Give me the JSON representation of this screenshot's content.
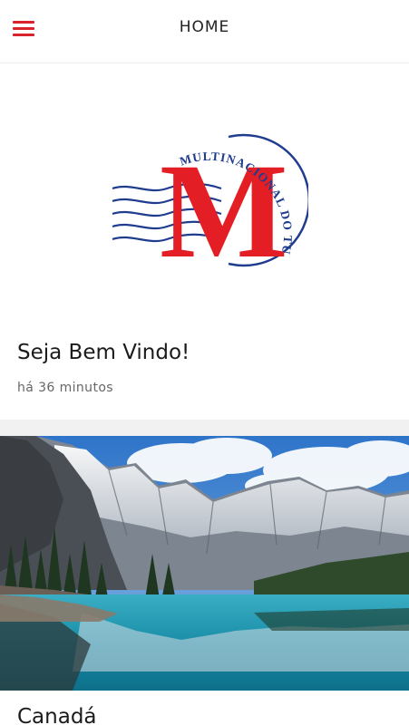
{
  "header": {
    "title": "HOME",
    "menu_icon": "hamburger-menu-icon",
    "accent_color": "#d9232d"
  },
  "feed": [
    {
      "logo": {
        "letter": "M",
        "text": "MULTINACIONAL DO TURISMO",
        "letter_color": "#e31e24",
        "text_color": "#1f3c8f"
      },
      "title": "Seja Bem Vindo!",
      "time": "há 36 minutos"
    },
    {
      "image": "mountain-lake-landscape",
      "title": "Canadá"
    }
  ]
}
